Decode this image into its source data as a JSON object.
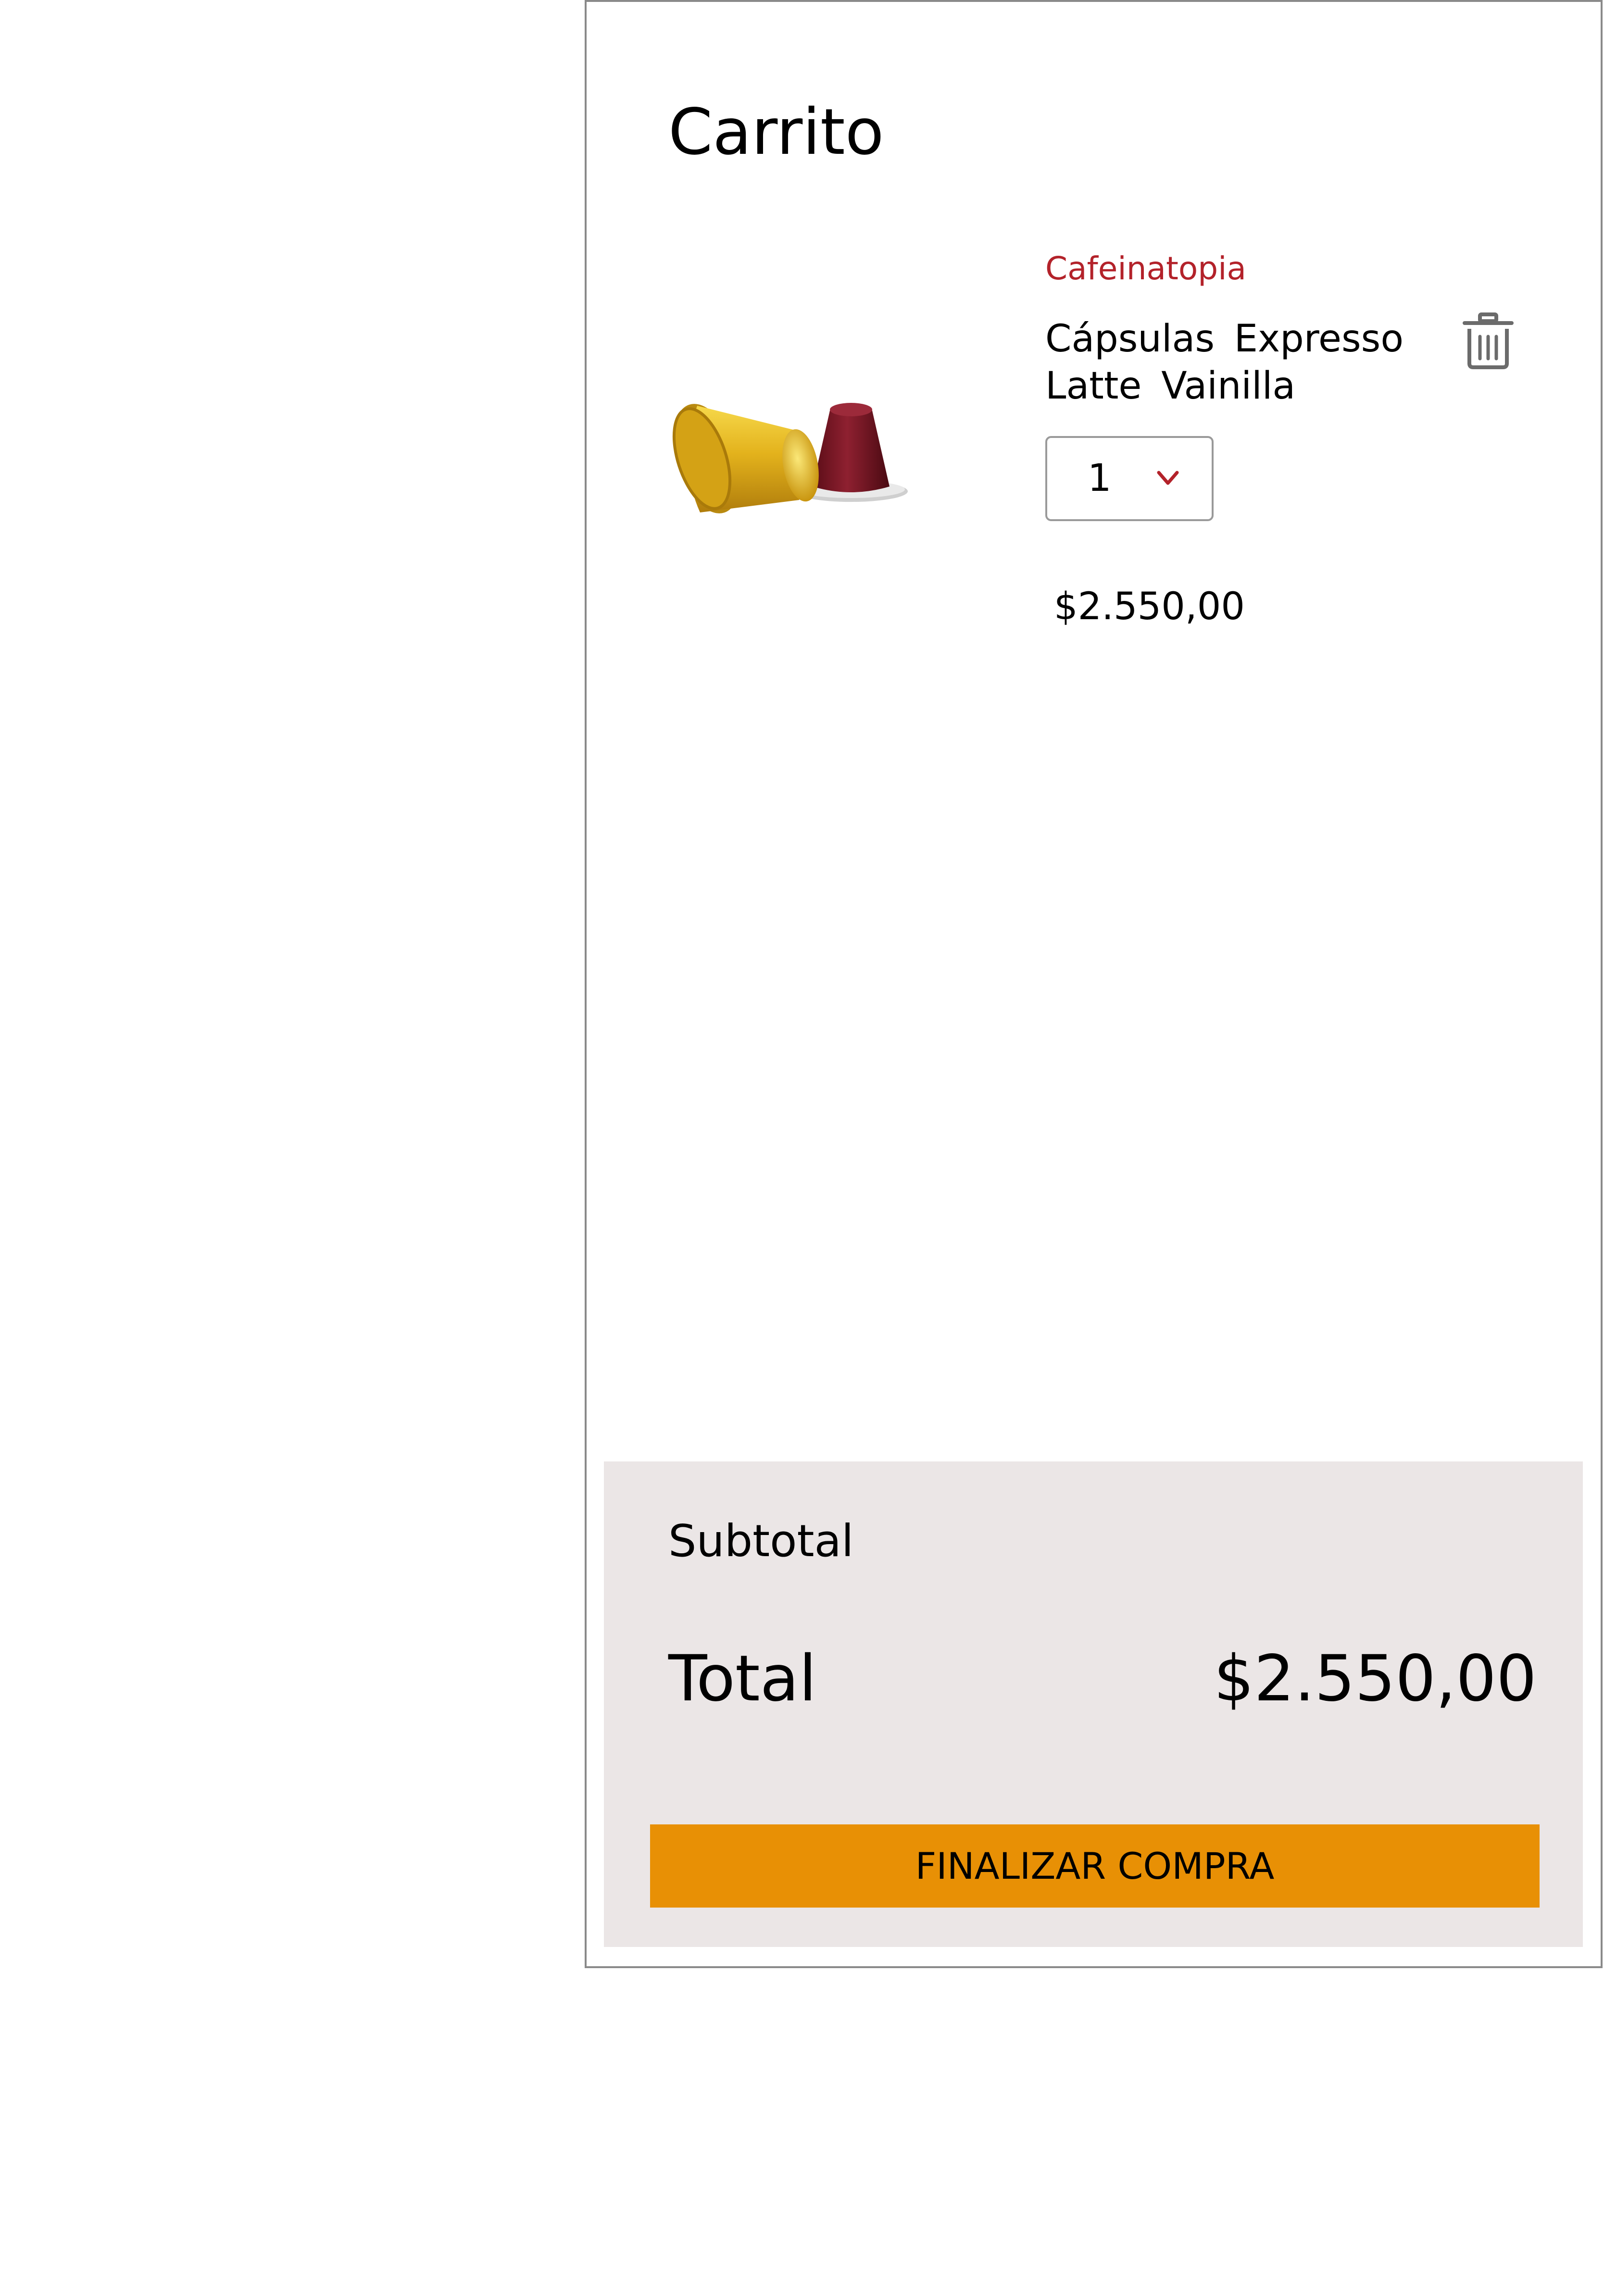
{
  "cart": {
    "title": "Carrito"
  },
  "item": {
    "brand": "Cafeinatopia",
    "name": "Cápsulas  Expresso Latte Vainilla",
    "image_icon": "coffee-capsules-image",
    "delete_icon": "trash-icon",
    "quantity": "1",
    "quantity_icon": "chevron-down-icon",
    "price": "$2.550,00"
  },
  "summary": {
    "subtotal_label": "Subtotal",
    "total_label": "Total",
    "total_value": "$2.550,00",
    "checkout_label": "FINALIZAR COMPRA"
  },
  "colors": {
    "brand_text": "#b3222a",
    "chevron": "#b3222a",
    "summary_background": "#ebe6e6",
    "checkout_button": "#e89005",
    "panel_border": "#8a8a8a",
    "icon_gray": "#6b6b6b",
    "capsule_gold": "#e3b21c",
    "capsule_red": "#7c1622"
  }
}
